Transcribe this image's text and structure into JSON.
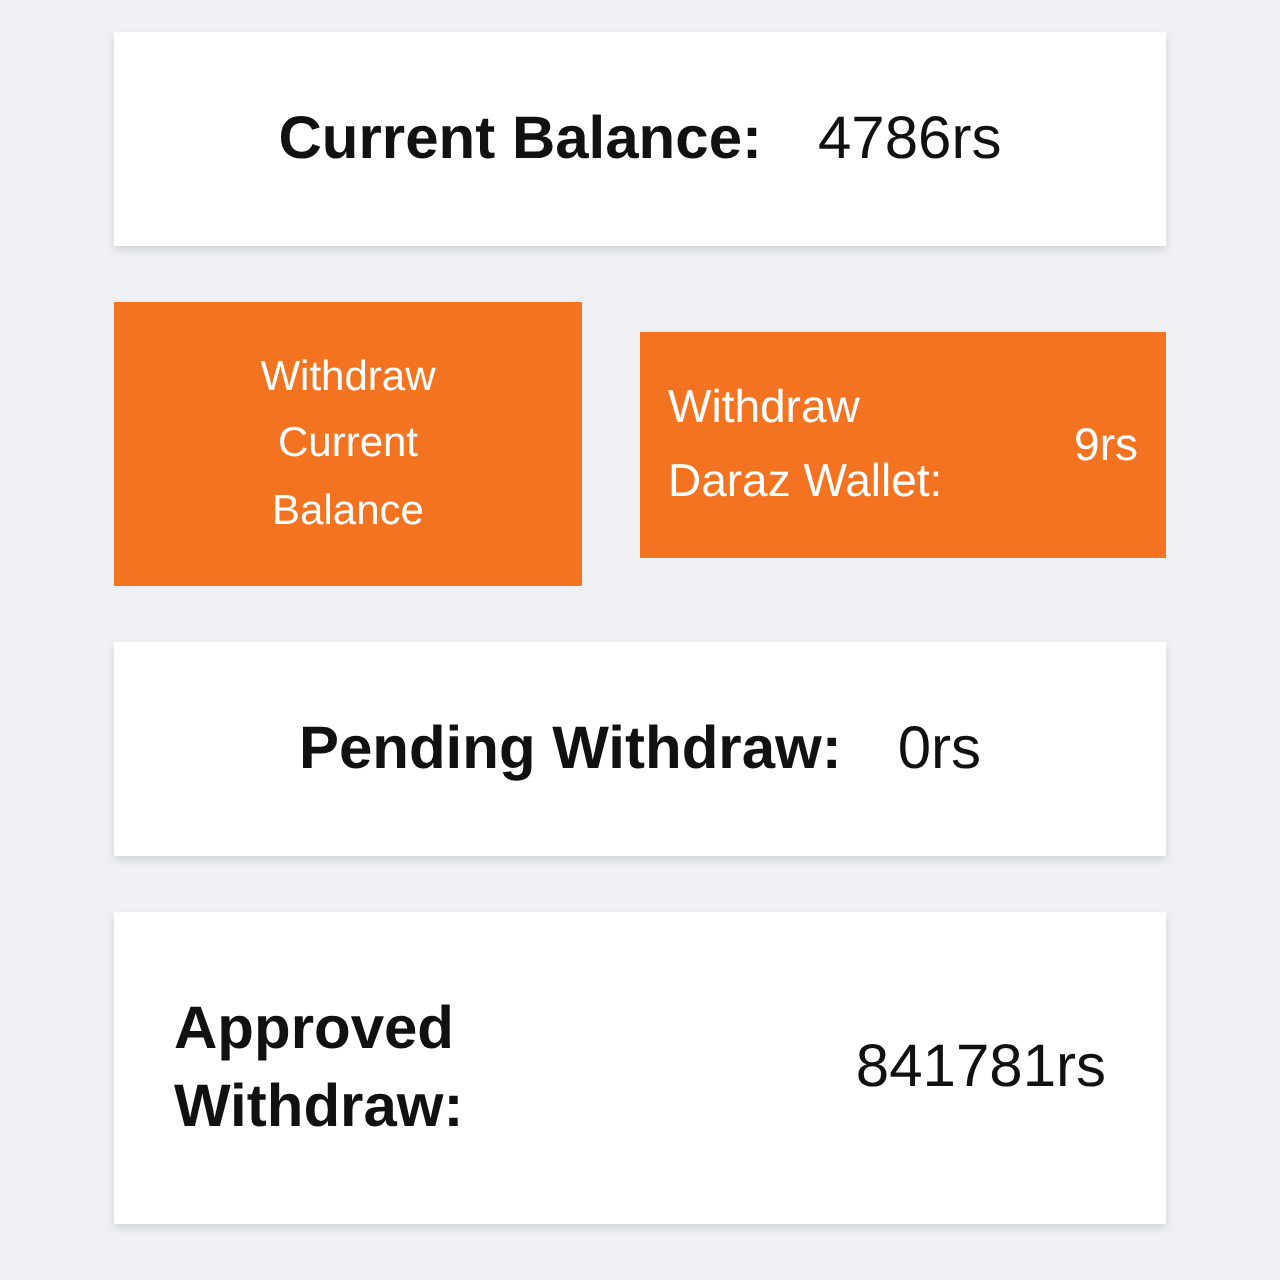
{
  "current_balance": {
    "label": "Current Balance:",
    "value": "4786rs"
  },
  "actions": [
    {
      "kind": "button",
      "lines": [
        "Withdraw",
        "Current",
        "Balance"
      ]
    },
    {
      "kind": "info",
      "lines": [
        "Withdraw",
        "Daraz Wallet:"
      ],
      "value": "9rs"
    }
  ],
  "pending": {
    "label": "Pending Withdraw:",
    "value": "0rs"
  },
  "approved": {
    "label": "Approved Withdraw:",
    "value": "841781rs"
  }
}
